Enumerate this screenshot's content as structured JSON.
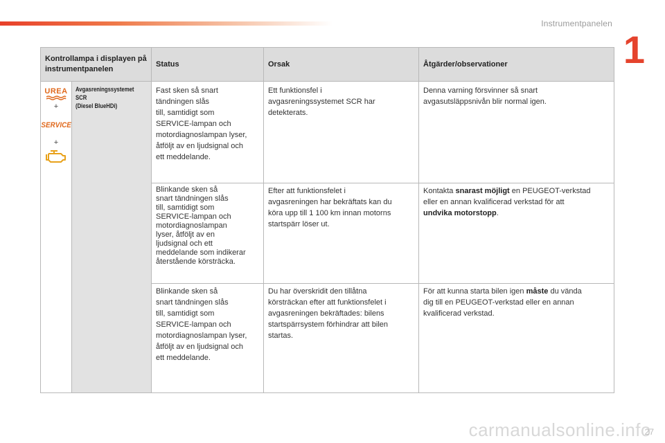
{
  "header": {
    "section_title": "Instrumentpanelen",
    "chapter_number": "1",
    "page_number": "27",
    "watermark": "carmanualsonline.info"
  },
  "table": {
    "columns": [
      "Kontrollampa i displayen på instrumentpanelen",
      "Status",
      "Orsak",
      "Åtgärder/observationer"
    ],
    "icons": {
      "urea_label": "UREA",
      "plus": "+",
      "service_label": "SERVICE",
      "colors": {
        "accent": "#e06a1e",
        "engine_icon": "#e8a11a"
      }
    },
    "system_name_lines": [
      "Avgasreningssystemet",
      "SCR",
      "(Diesel BlueHDi)"
    ],
    "rows": [
      {
        "status": "Fast sken så snart\ntändningen slås\ntill, samtidigt som\nSERVICE-lampan och\nmotordiagnoslampan lyser,\nåtföljt av en ljudsignal och\nett meddelande.",
        "cause": "Ett funktionsfel i\navgasreningssystemet SCR har\ndetekterats.",
        "action_parts": [
          "Denna varning försvinner så snart\navgasutsläppsnivån blir normal igen."
        ]
      },
      {
        "status": "Blinkande sken så\nsnart tändningen slås\ntill, samtidigt som\nSERVICE-lampan och\nmotordiagnoslampan\nlyser, åtföljt av en\nljudsignal och ett\nmeddelande som indikerar\nåterstående körsträcka.",
        "cause": "Efter att funktionsfelet i\navgasreningen har bekräftats kan du\nköra upp till 1 100 km innan motorns\nstartspärr löser ut.",
        "action_parts": [
          "Kontakta ",
          "snarast möjligt",
          " en PEUGEOT-verkstad\neller en annan kvalificerad verkstad för att\n",
          "undvika motorstopp",
          "."
        ]
      },
      {
        "status": "Blinkande sken så\nsnart tändningen slås\ntill, samtidigt som\nSERVICE-lampan och\nmotordiagnoslampan lyser,\nåtföljt av en ljudsignal och\nett meddelande.",
        "cause": "Du har överskridit den tillåtna\nkörsträckan efter att funktionsfelet i\navgasreningen bekräftades: bilens\nstartspärrsystem förhindrar att bilen\nstartas.",
        "action_parts": [
          "För att kunna starta bilen igen ",
          "måste",
          " du vända\ndig till en PEUGEOT-verkstad eller en annan\nkvalificerad verkstad."
        ]
      }
    ]
  }
}
